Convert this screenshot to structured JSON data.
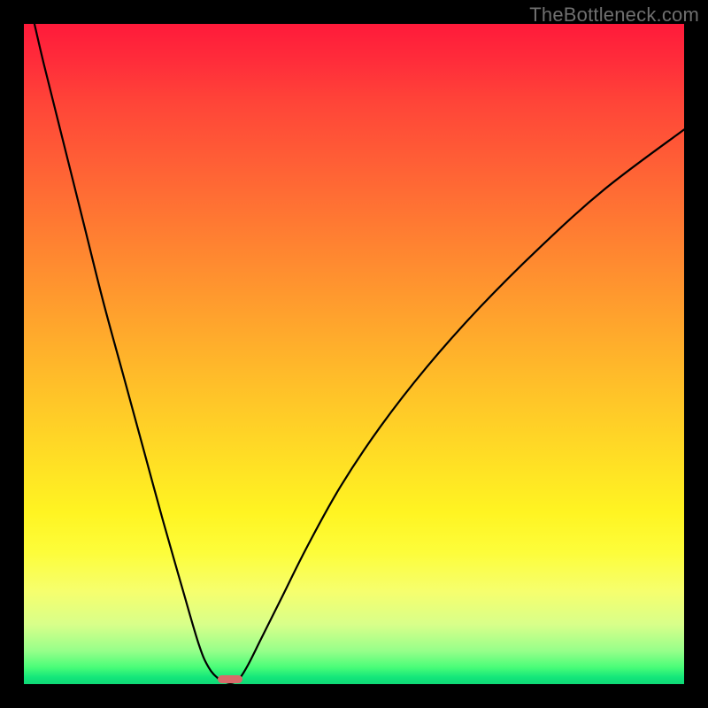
{
  "watermark": "TheBottleneck.com",
  "chart_data": {
    "type": "line",
    "title": "",
    "xlabel": "",
    "ylabel": "",
    "xlim": [
      0,
      100
    ],
    "ylim": [
      0,
      100
    ],
    "grid": false,
    "series": [
      {
        "name": "curve",
        "x": [
          1.6,
          3,
          6,
          9,
          12,
          15,
          18,
          21,
          24,
          26.5,
          28,
          29.5,
          30.7,
          31.2,
          31.8,
          32.7,
          34,
          36,
          39,
          43,
          48,
          54,
          61,
          69,
          78,
          88,
          100
        ],
        "y": [
          100,
          94,
          82,
          70,
          58,
          47,
          36,
          25,
          14.5,
          6,
          2.5,
          0.8,
          0.25,
          0.15,
          0.25,
          0.9,
          3,
          7,
          13,
          21,
          30,
          39,
          48,
          57,
          66,
          75,
          84
        ]
      }
    ],
    "marker": {
      "x_center": 31.2,
      "width": 3.8,
      "height": 1.2
    },
    "background_gradient": {
      "top": "#ff1a3a",
      "bottom": "#0fd876"
    }
  }
}
